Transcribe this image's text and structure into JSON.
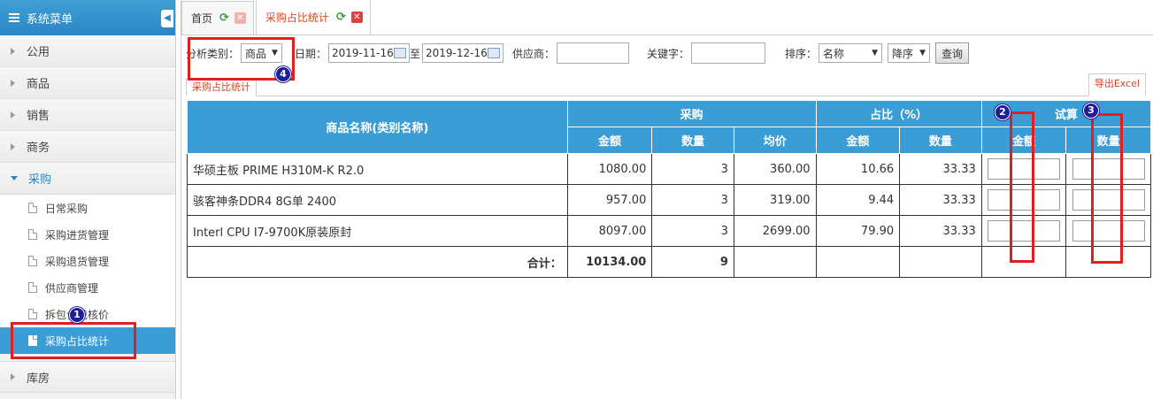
{
  "sidebar": {
    "title": "系统菜单",
    "groups": [
      {
        "label": "公用"
      },
      {
        "label": "商品"
      },
      {
        "label": "销售"
      },
      {
        "label": "商务"
      },
      {
        "label": "采购"
      },
      {
        "label": "库房"
      }
    ],
    "purchase_items": [
      {
        "label": "日常采购"
      },
      {
        "label": "采购进货管理"
      },
      {
        "label": "采购退货管理"
      },
      {
        "label": "供应商管理"
      },
      {
        "label": "拆包合拢核价"
      },
      {
        "label": "采购占比统计"
      }
    ]
  },
  "tabs": [
    {
      "label": "首页"
    },
    {
      "label": "采购占比统计"
    }
  ],
  "toolbar": {
    "category_label": "分析类别：",
    "category_value": "商品",
    "date_label": "日期：",
    "date_from": "2019-11-16",
    "to_label": "至",
    "date_to": "2019-12-16",
    "supplier_label": "供应商：",
    "supplier_value": "",
    "keyword_label": "关键字：",
    "keyword_value": "",
    "sort_label": "排序：",
    "sort_field": "名称",
    "sort_order": "降序",
    "query_button": "查询"
  },
  "subtab": "采购占比统计",
  "export_label": "导出Excel",
  "table": {
    "headers": {
      "name": "商品名称(类别名称)",
      "purchase": "采购",
      "ratio": "占比（%）",
      "calc": "试算",
      "amount": "金额",
      "qty": "数量",
      "avg": "均价"
    },
    "rows": [
      {
        "name": "华硕主板 PRIME H310M-K R2.0",
        "amount": "1080.00",
        "qty": "3",
        "avg": "360.00",
        "ratio_amount": "10.66",
        "ratio_qty": "33.33"
      },
      {
        "name": "骇客神条DDR4 8G单 2400",
        "amount": "957.00",
        "qty": "3",
        "avg": "319.00",
        "ratio_amount": "9.44",
        "ratio_qty": "33.33"
      },
      {
        "name": "Interl CPU I7-9700K原装原封",
        "amount": "8097.00",
        "qty": "3",
        "avg": "2699.00",
        "ratio_amount": "79.90",
        "ratio_qty": "33.33"
      }
    ],
    "total": {
      "label": "合计：",
      "amount": "10134.00",
      "qty": "9"
    }
  },
  "markers": {
    "m1": "1",
    "m2": "2",
    "m3": "3",
    "m4": "4"
  }
}
